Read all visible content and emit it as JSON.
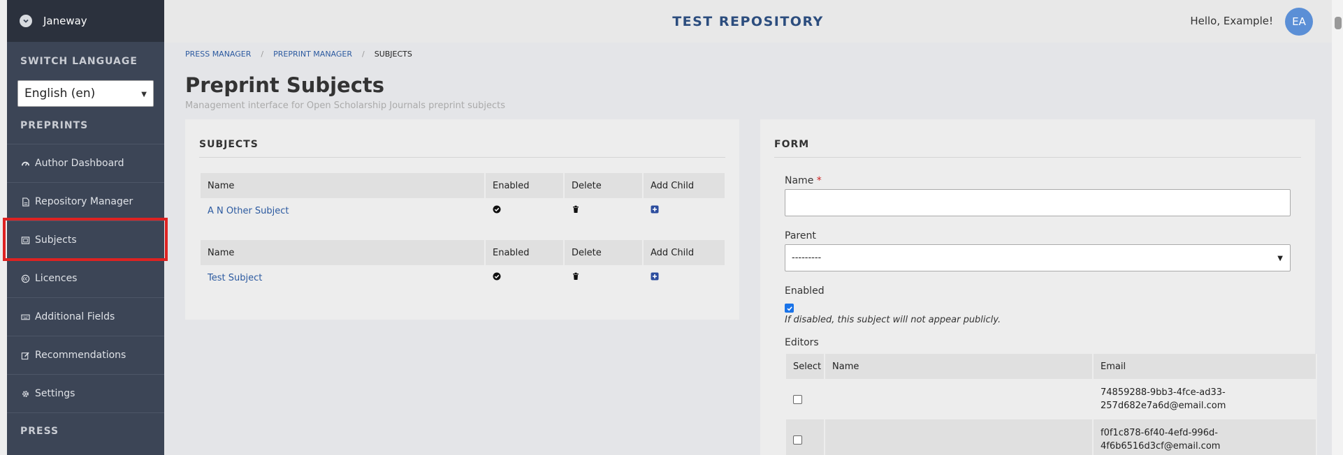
{
  "sidebar": {
    "brand": "Janeway",
    "switch_language_title": "SWITCH LANGUAGE",
    "language_selected": "English (en)",
    "preprints_title": "PREPRINTS",
    "items": [
      {
        "label": "Author Dashboard",
        "icon": "dashboard-icon"
      },
      {
        "label": "Repository Manager",
        "icon": "file-icon"
      },
      {
        "label": "Subjects",
        "icon": "subjects-icon"
      },
      {
        "label": "Licences",
        "icon": "cc-icon"
      },
      {
        "label": "Additional Fields",
        "icon": "keyboard-icon"
      },
      {
        "label": "Recommendations",
        "icon": "edit-icon"
      },
      {
        "label": "Settings",
        "icon": "gear-icon"
      }
    ],
    "press_title": "PRESS"
  },
  "header": {
    "title": "TEST REPOSITORY",
    "greeting": "Hello, Example!",
    "avatar_initials": "EA"
  },
  "breadcrumb": [
    "PRESS MANAGER",
    "PREPRINT MANAGER",
    "SUBJECTS"
  ],
  "page": {
    "title": "Preprint Subjects",
    "subtitle": "Management interface for Open Scholarship Journals preprint subjects"
  },
  "subjects_panel": {
    "title": "SUBJECTS",
    "columns": [
      "Name",
      "Enabled",
      "Delete",
      "Add Child"
    ],
    "rows": [
      "A N Other Subject",
      "Test Subject"
    ]
  },
  "form_panel": {
    "title": "FORM",
    "name_label": "Name",
    "required_mark": "*",
    "parent_label": "Parent",
    "parent_selected": "---------",
    "enabled_label": "Enabled",
    "enabled_help": "If disabled, this subject will not appear publicly.",
    "editors_label": "Editors",
    "editors_columns": [
      "Select",
      "Name",
      "Email"
    ],
    "editors": [
      {
        "name": "",
        "email_line1": "74859288-9bb3-4fce-ad33-",
        "email_line2": "257d682e7a6d@email.com"
      },
      {
        "name": "",
        "email_line1": "f0f1c878-6f40-4efd-996d-",
        "email_line2": "4f6b6516d3cf@email.com"
      }
    ]
  },
  "colors": {
    "sidebar_bg": "#3c4556",
    "accent": "#2c4d7e",
    "link": "#2c5aa0",
    "avatar": "#5b8fd6",
    "highlight": "#dd2222"
  }
}
